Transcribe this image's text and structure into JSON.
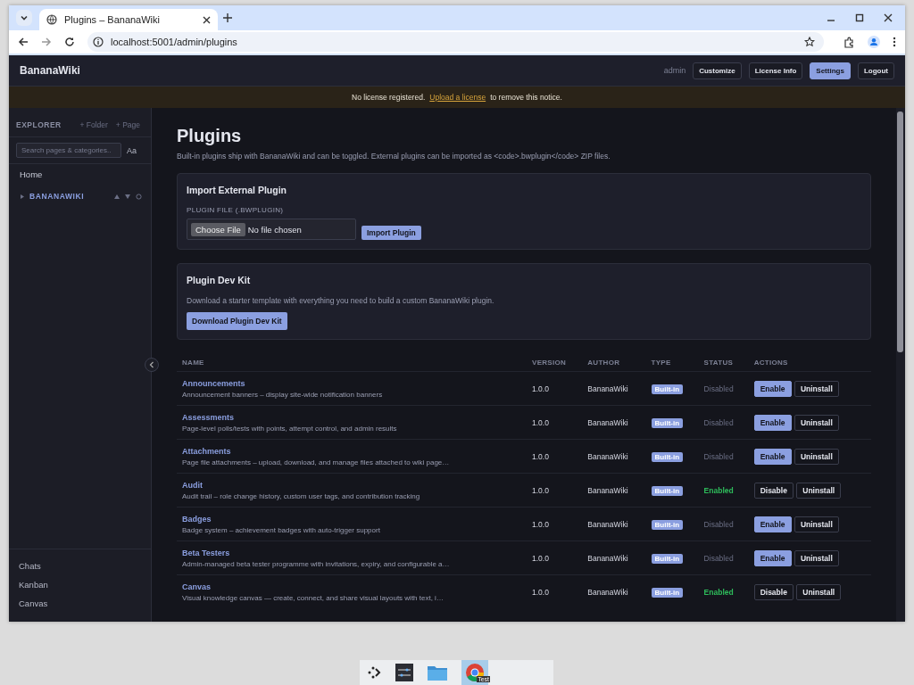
{
  "browser": {
    "tab_title": "Plugins – BananaWiki",
    "url": "localhost:5001/admin/plugins"
  },
  "header": {
    "brand": "BananaWiki",
    "user": "admin",
    "buttons": [
      {
        "label": "Customize",
        "selected": false
      },
      {
        "label": "License Info",
        "selected": false
      },
      {
        "label": "Settings",
        "selected": true
      },
      {
        "label": "Logout",
        "selected": false
      }
    ]
  },
  "notice": {
    "before": "No license registered.",
    "link": "Upload a license",
    "after": "to remove this notice."
  },
  "sidebar": {
    "title": "EXPLORER",
    "actions": [
      "+ Folder",
      "+ Page"
    ],
    "search_placeholder": "Search pages & categories..",
    "case_toggle": "Aa",
    "home": "Home",
    "category": "BANANAWIKI",
    "bottom_links": [
      "Chats",
      "Kanban",
      "Canvas"
    ]
  },
  "page": {
    "title": "Plugins",
    "intro": "Built-in plugins ship with BananaWiki and can be toggled. External plugins can be imported as <code>.bwplugin</code> ZIP files.",
    "import_card": {
      "title": "Import External Plugin",
      "field_label": "PLUGIN FILE (.BWPLUGIN)",
      "choose_button": "Choose File",
      "file_status": "No file chosen",
      "submit": "Import Plugin"
    },
    "devkit_card": {
      "title": "Plugin Dev Kit",
      "text": "Download a starter template with everything you need to build a custom BananaWiki plugin.",
      "button": "Download Plugin Dev Kit"
    }
  },
  "table": {
    "columns": [
      "NAME",
      "VERSION",
      "AUTHOR",
      "TYPE",
      "STATUS",
      "ACTIONS"
    ],
    "rows": [
      {
        "name": "Announcements",
        "description": "Announcement banners – display site-wide notification banners",
        "version": "1.0.0",
        "author": "BananaWiki",
        "type": "Built-in",
        "status": "Disabled",
        "enabled": false,
        "toggle": "Enable",
        "uninstall": "Uninstall"
      },
      {
        "name": "Assessments",
        "description": "Page-level polls/tests with points, attempt control, and admin results",
        "version": "1.0.0",
        "author": "BananaWiki",
        "type": "Built-in",
        "status": "Disabled",
        "enabled": false,
        "toggle": "Enable",
        "uninstall": "Uninstall"
      },
      {
        "name": "Attachments",
        "description": "Page file attachments – upload, download, and manage files attached to wiki page…",
        "version": "1.0.0",
        "author": "BananaWiki",
        "type": "Built-in",
        "status": "Disabled",
        "enabled": false,
        "toggle": "Enable",
        "uninstall": "Uninstall"
      },
      {
        "name": "Audit",
        "description": "Audit trail – role change history, custom user tags, and contribution tracking",
        "version": "1.0.0",
        "author": "BananaWiki",
        "type": "Built-in",
        "status": "Enabled",
        "enabled": true,
        "toggle": "Disable",
        "uninstall": "Uninstall"
      },
      {
        "name": "Badges",
        "description": "Badge system – achievement badges with auto-trigger support",
        "version": "1.0.0",
        "author": "BananaWiki",
        "type": "Built-in",
        "status": "Disabled",
        "enabled": false,
        "toggle": "Enable",
        "uninstall": "Uninstall"
      },
      {
        "name": "Beta Testers",
        "description": "Admin-managed beta tester programme with invitations, expiry, and configurable a…",
        "version": "1.0.0",
        "author": "BananaWiki",
        "type": "Built-in",
        "status": "Disabled",
        "enabled": false,
        "toggle": "Enable",
        "uninstall": "Uninstall"
      },
      {
        "name": "Canvas",
        "description": "Visual knowledge canvas — create, connect, and share visual layouts with text, i…",
        "version": "1.0.0",
        "author": "BananaWiki",
        "type": "Built-in",
        "status": "Enabled",
        "enabled": true,
        "toggle": "Disable",
        "uninstall": "Uninstall"
      }
    ]
  },
  "taskbar": {
    "badge": "Test"
  }
}
